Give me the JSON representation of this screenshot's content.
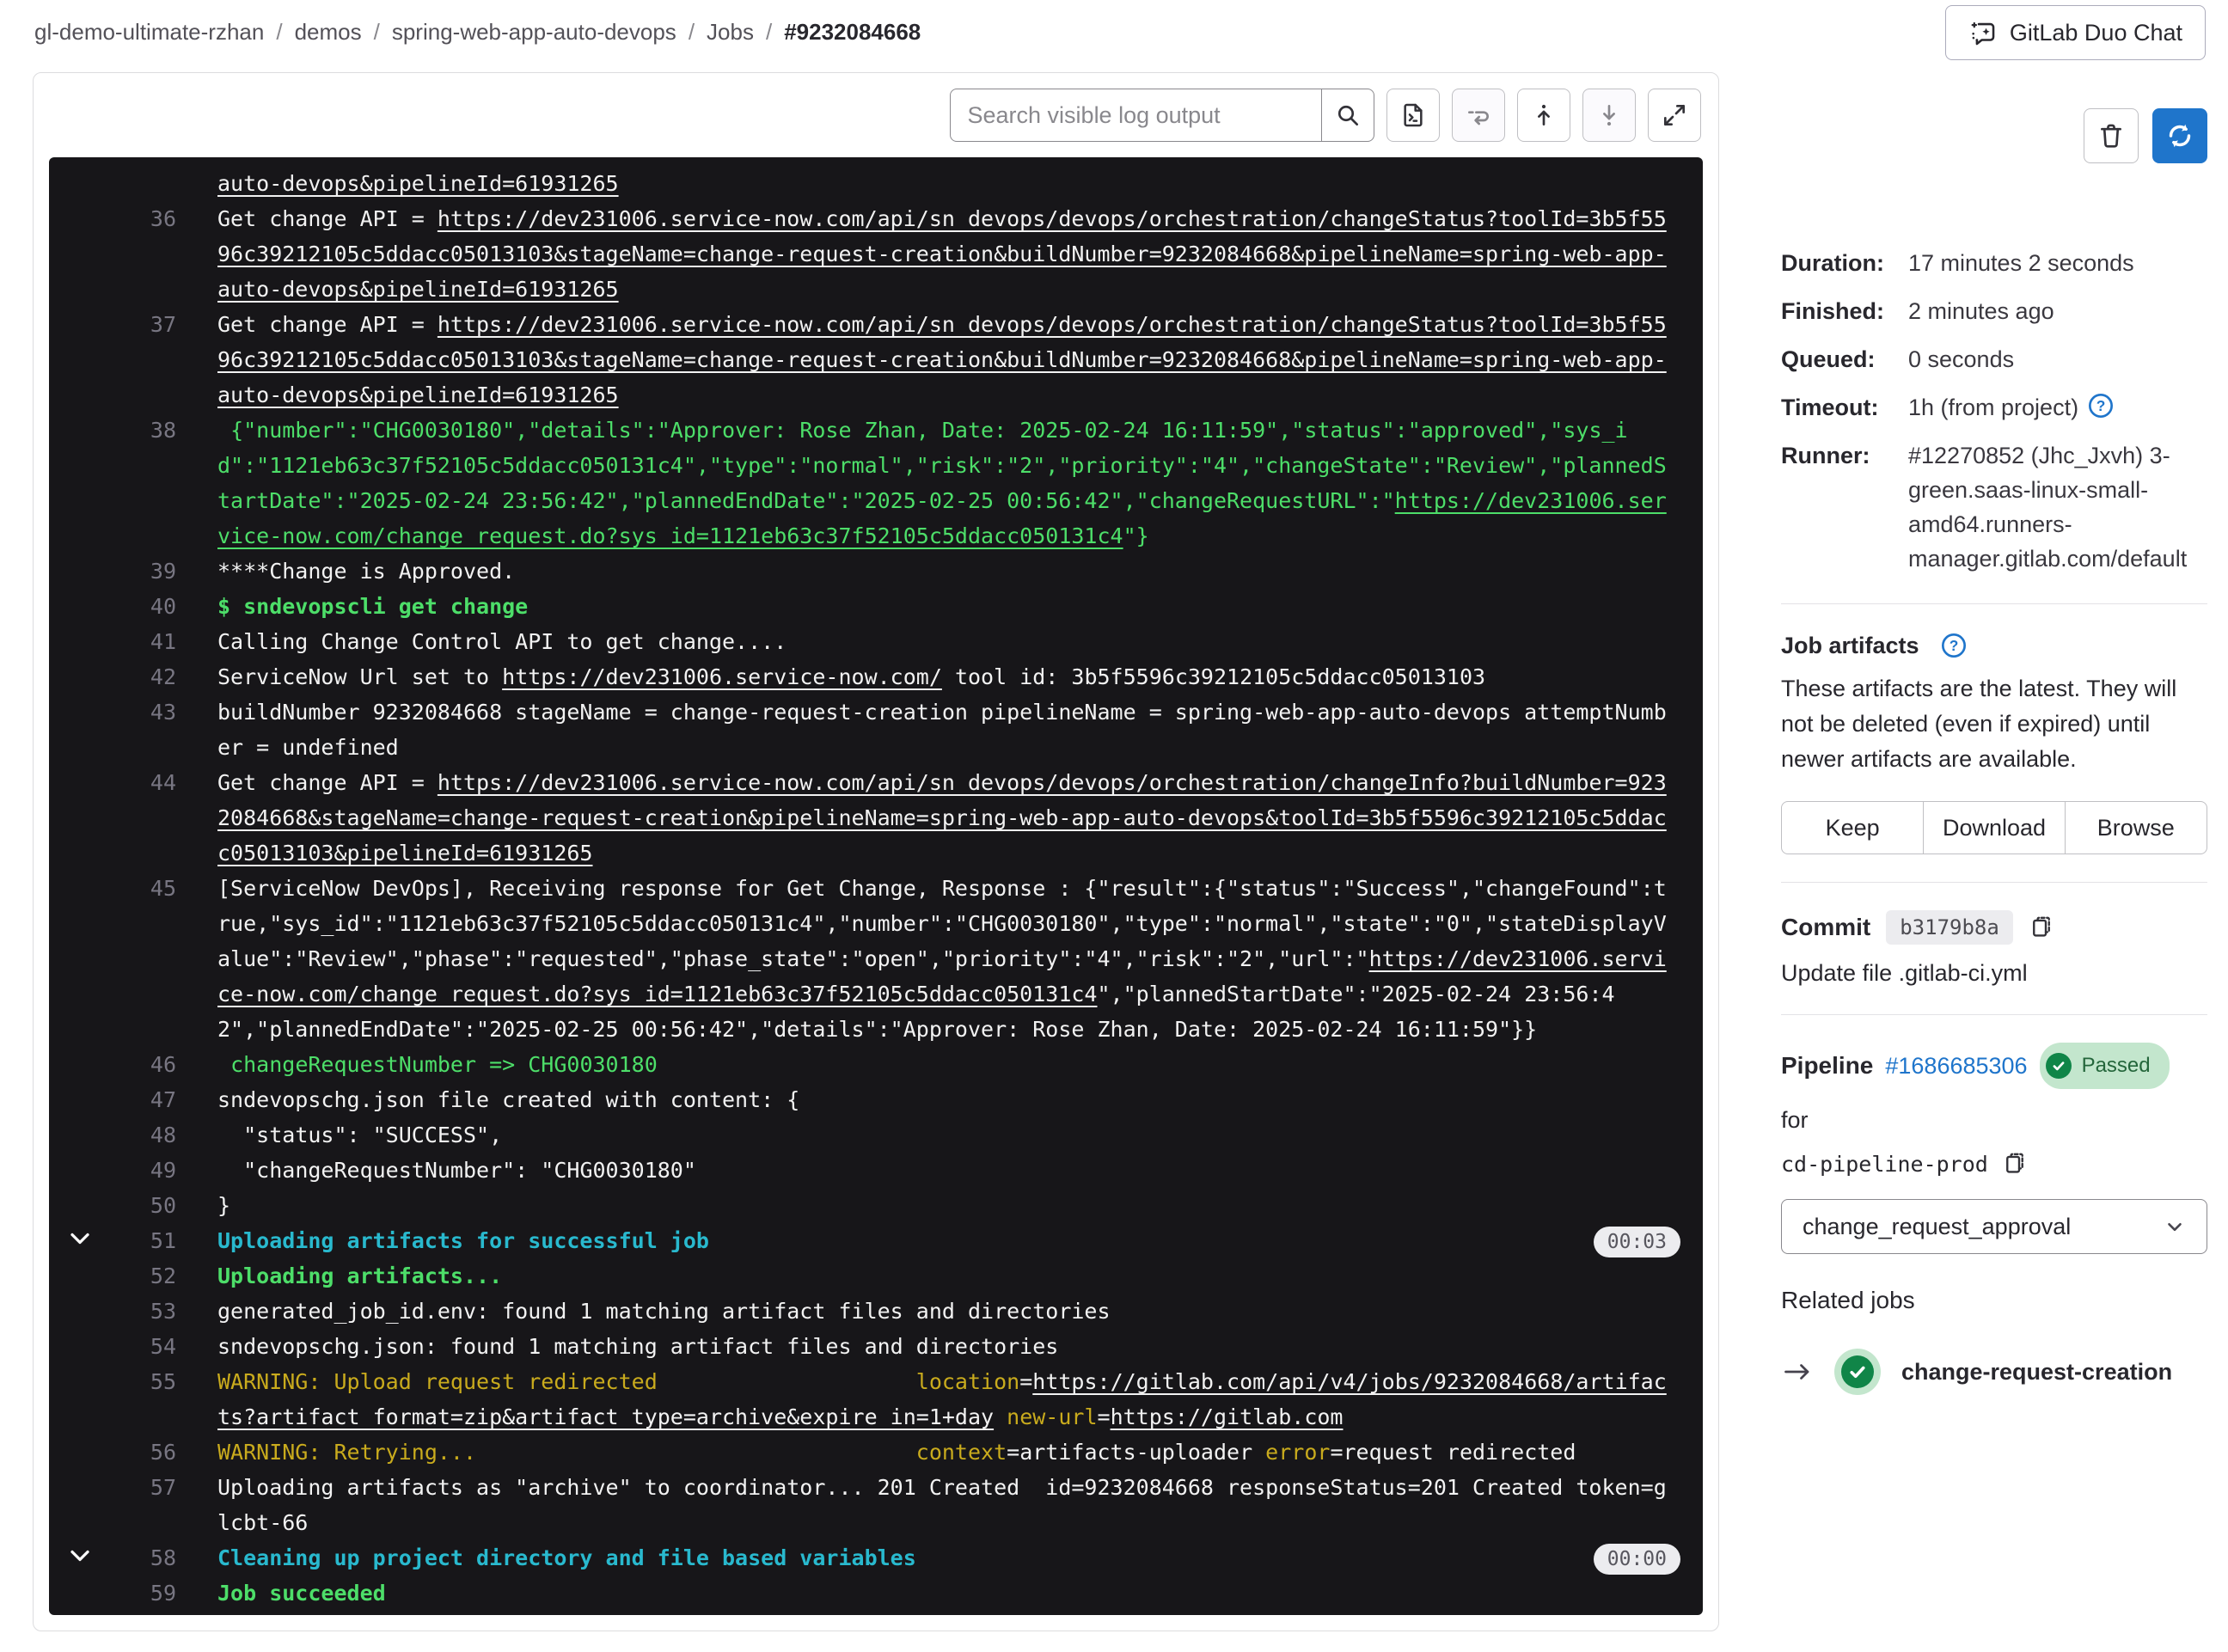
{
  "breadcrumb": {
    "items": [
      "gl-demo-ultimate-rzhan",
      "demos",
      "spring-web-app-auto-devops",
      "Jobs"
    ],
    "current": "#9232084668"
  },
  "header": {
    "duo_chat_label": "GitLab Duo Chat"
  },
  "toolbar": {
    "search_placeholder": "Search visible log output",
    "icons": [
      "search-icon",
      "raw-log-icon",
      "wrap-lines-icon",
      "scroll-top-icon",
      "scroll-bottom-icon",
      "fullscreen-icon"
    ]
  },
  "sidebar": {
    "action_icons": [
      "trash-icon",
      "retry-icon"
    ],
    "details": [
      {
        "label": "Duration:",
        "value": "17 minutes 2 seconds",
        "help": false
      },
      {
        "label": "Finished:",
        "value": "2 minutes ago",
        "help": false
      },
      {
        "label": "Queued:",
        "value": "0 seconds",
        "help": false
      },
      {
        "label": "Timeout:",
        "value": "1h (from project)",
        "help": true
      },
      {
        "label": "Runner:",
        "value": "#12270852 (Jhc_Jxvh) 3-green.saas-linux-small-amd64.runners-manager.gitlab.com/default",
        "help": false
      }
    ],
    "artifacts": {
      "title": "Job artifacts",
      "description": "These artifacts are the latest. They will not be deleted (even if expired) until newer artifacts are available.",
      "buttons": [
        "Keep",
        "Download",
        "Browse"
      ]
    },
    "commit": {
      "label": "Commit",
      "sha": "b3179b8a",
      "message": "Update file .gitlab-ci.yml"
    },
    "pipeline": {
      "label": "Pipeline",
      "id": "#1686685306",
      "status": "Passed",
      "for_text": "for",
      "ref": "cd-pipeline-prod",
      "dropdown_value": "change_request_approval"
    },
    "related_jobs": {
      "title": "Related jobs",
      "jobs": [
        {
          "name": "change-request-creation",
          "status": "passed"
        }
      ]
    }
  },
  "colors": {
    "log_bg": "#171619",
    "log_green": "#4dde69",
    "log_cyan": "#29b9ce",
    "log_yellow": "#c9ab1d",
    "link_blue": "#1f75cb",
    "retry_blue": "#1f75cb",
    "passed_bg": "#c3e6cd",
    "passed_text": "#24663b",
    "status_green": "#108548"
  },
  "log": {
    "lines": [
      {
        "num": "",
        "segs": [
          {
            "t": "auto-devops&pipelineId=61931265",
            "c": "wl"
          }
        ]
      },
      {
        "num": "36",
        "segs": [
          {
            "t": "Get change API = ",
            "c": "w"
          },
          {
            "t": "https://dev231006.service-now.com/api/sn_devops/devops/orchestration/changeStatus?toolId=3b5f5596c39212105c5ddacc05013103&stageName=change-request-creation&buildNumber=9232084668&pipelineName=spring-web-app-auto-devops&pipelineId=61931265",
            "c": "wl"
          }
        ]
      },
      {
        "num": "37",
        "segs": [
          {
            "t": "Get change API = ",
            "c": "w"
          },
          {
            "t": "https://dev231006.service-now.com/api/sn_devops/devops/orchestration/changeStatus?toolId=3b5f5596c39212105c5ddacc05013103&stageName=change-request-creation&buildNumber=9232084668&pipelineName=spring-web-app-auto-devops&pipelineId=61931265",
            "c": "wl"
          }
        ]
      },
      {
        "num": "38",
        "segs": [
          {
            "t": " {\"number\":\"CHG0030180\",\"details\":\"Approver: Rose Zhan, Date: 2025-02-24 16:11:59\",\"status\":\"approved\",\"sys_id\":\"1121eb63c37f52105c5ddacc050131c4\",\"type\":\"normal\",\"risk\":\"2\",\"priority\":\"4\",\"changeState\":\"Review\",\"plannedStartDate\":\"2025-02-24 23:56:42\",\"plannedEndDate\":\"2025-02-25 00:56:42\",\"changeRequestURL\":\"",
            "c": "g"
          },
          {
            "t": "https://dev231006.service-now.com/change_request.do?sys_id=1121eb63c37f52105c5ddacc050131c4",
            "c": "gl"
          },
          {
            "t": "\"}",
            "c": "g"
          }
        ]
      },
      {
        "num": "39",
        "segs": [
          {
            "t": "****Change is Approved.",
            "c": "w"
          }
        ]
      },
      {
        "num": "40",
        "segs": [
          {
            "t": "$ sndevopscli get change",
            "c": "gb"
          }
        ]
      },
      {
        "num": "41",
        "segs": [
          {
            "t": "Calling Change Control API to get change....",
            "c": "w"
          }
        ]
      },
      {
        "num": "42",
        "segs": [
          {
            "t": "ServiceNow Url set to ",
            "c": "w"
          },
          {
            "t": "https://dev231006.service-now.com/",
            "c": "wl"
          },
          {
            "t": " tool id: 3b5f5596c39212105c5ddacc05013103",
            "c": "w"
          }
        ]
      },
      {
        "num": "43",
        "segs": [
          {
            "t": "buildNumber 9232084668 stageName = change-request-creation pipelineName = spring-web-app-auto-devops attemptNumber = undefined",
            "c": "w"
          }
        ]
      },
      {
        "num": "44",
        "segs": [
          {
            "t": "Get change API = ",
            "c": "w"
          },
          {
            "t": "https://dev231006.service-now.com/api/sn_devops/devops/orchestration/changeInfo?buildNumber=9232084668&stageName=change-request-creation&pipelineName=spring-web-app-auto-devops&toolId=3b5f5596c39212105c5ddacc05013103&pipelineId=61931265",
            "c": "wl"
          }
        ]
      },
      {
        "num": "45",
        "segs": [
          {
            "t": "[ServiceNow DevOps], Receiving response for Get Change, Response : {\"result\":{\"status\":\"Success\",\"changeFound\":true,\"sys_id\":\"1121eb63c37f52105c5ddacc050131c4\",\"number\":\"CHG0030180\",\"type\":\"normal\",\"state\":\"0\",\"stateDisplayValue\":\"Review\",\"phase\":\"requested\",\"phase_state\":\"open\",\"priority\":\"4\",\"risk\":\"2\",\"url\":\"",
            "c": "w"
          },
          {
            "t": "https://dev231006.service-now.com/change_request.do?sys_id=1121eb63c37f52105c5ddacc050131c4",
            "c": "wl"
          },
          {
            "t": "\",\"plannedStartDate\":\"2025-02-24 23:56:42\",\"plannedEndDate\":\"2025-02-25 00:56:42\",\"details\":\"Approver: Rose Zhan, Date: 2025-02-24 16:11:59\"}}",
            "c": "w"
          }
        ]
      },
      {
        "num": "46",
        "segs": [
          {
            "t": " changeRequestNumber => CHG0030180",
            "c": "g"
          }
        ]
      },
      {
        "num": "47",
        "segs": [
          {
            "t": "sndevopschg.json file created with content: {",
            "c": "w"
          }
        ]
      },
      {
        "num": "48",
        "segs": [
          {
            "t": "  \"status\": \"SUCCESS\",",
            "c": "w"
          }
        ]
      },
      {
        "num": "49",
        "segs": [
          {
            "t": "  \"changeRequestNumber\": \"CHG0030180\"",
            "c": "w"
          }
        ]
      },
      {
        "num": "50",
        "segs": [
          {
            "t": "}",
            "c": "w"
          }
        ]
      },
      {
        "num": "51",
        "chevron": true,
        "badge": "00:03",
        "segs": [
          {
            "t": "Uploading artifacts for successful job",
            "c": "section"
          }
        ]
      },
      {
        "num": "52",
        "segs": [
          {
            "t": "Uploading artifacts...",
            "c": "gb"
          }
        ]
      },
      {
        "num": "53",
        "segs": [
          {
            "t": "generated_job_id.env: found 1 matching artifact files and directories",
            "c": "w"
          }
        ]
      },
      {
        "num": "54",
        "segs": [
          {
            "t": "sndevopschg.json: found 1 matching artifact files and directories",
            "c": "w"
          }
        ]
      },
      {
        "num": "55",
        "segs": [
          {
            "t": "WARNING: Upload request redirected",
            "c": "y"
          },
          {
            "t": "                    ",
            "c": "w"
          },
          {
            "t": "location",
            "c": "y"
          },
          {
            "t": "=",
            "c": "w"
          },
          {
            "t": "https://gitlab.com/api/v4/jobs/9232084668/artifacts?artifact_format=zip&artifact_type=archive&expire_in=1+day",
            "c": "wl"
          },
          {
            "t": " ",
            "c": "w"
          },
          {
            "t": "new-url",
            "c": "y"
          },
          {
            "t": "=",
            "c": "w"
          },
          {
            "t": "https://gitlab.com",
            "c": "wl"
          }
        ]
      },
      {
        "num": "56",
        "segs": [
          {
            "t": "WARNING: Retrying...",
            "c": "y"
          },
          {
            "t": "                                  ",
            "c": "w"
          },
          {
            "t": "context",
            "c": "y"
          },
          {
            "t": "=artifacts-uploader ",
            "c": "w"
          },
          {
            "t": "error",
            "c": "y"
          },
          {
            "t": "=request redirected",
            "c": "w"
          }
        ]
      },
      {
        "num": "57",
        "segs": [
          {
            "t": "Uploading artifacts as \"archive\" to coordinator... 201 Created  id=9232084668 responseStatus=201 Created token=glcbt-66",
            "c": "w"
          }
        ]
      },
      {
        "num": "58",
        "chevron": true,
        "badge": "00:00",
        "segs": [
          {
            "t": "Cleaning up project directory and file based variables",
            "c": "section"
          }
        ]
      },
      {
        "num": "59",
        "segs": [
          {
            "t": "Job succeeded",
            "c": "gb"
          }
        ]
      }
    ]
  }
}
